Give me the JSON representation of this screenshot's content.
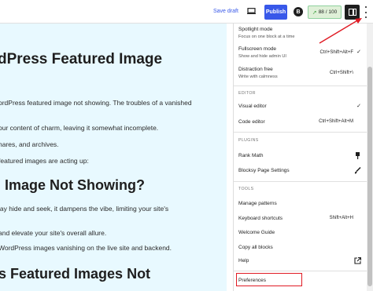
{
  "toolbar": {
    "save_draft": "Save draft",
    "publish": "Publish",
    "blocksy_letter": "B",
    "score": "88 / 100",
    "icons": [
      "desktop-preview-icon",
      "blocksy-icon",
      "rank-math-score-icon",
      "settings-panel-icon",
      "options-kebab-icon"
    ]
  },
  "canvas": {
    "heading1": "dPress Featured Image",
    "line1": "ordPress featured image not showing. The troubles of a vanished",
    "line2": "our content of charm, leaving it somewhat incomplete.",
    "line3": "hares, and archives.",
    "line4": "featured images are acting up:",
    "heading2": "Image Not Showing?",
    "line5": "lay hide and seek, it dampens the vibe, limiting your site's",
    "line6": "and elevate your site's overall allure.",
    "line7": "WordPress images vanishing on the live site and backend.",
    "heading3": "s Featured Images Not"
  },
  "menu": {
    "view": [
      {
        "label": "Spotlight mode",
        "desc": "Focus on one block at a time",
        "shortcut": "",
        "checked": false
      },
      {
        "label": "Fullscreen mode",
        "desc": "Show and hide admin UI",
        "shortcut": "Ctrl+Shift+Alt+F",
        "checked": true
      },
      {
        "label": "Distraction free",
        "desc": "Write with calmness",
        "shortcut": "Ctrl+Shift+\\",
        "checked": false
      }
    ],
    "editor_title": "EDITOR",
    "editor": [
      {
        "label": "Visual editor",
        "shortcut": "",
        "checked": true
      },
      {
        "label": "Code editor",
        "shortcut": "Ctrl+Shift+Alt+M",
        "checked": false
      }
    ],
    "plugins_title": "PLUGINS",
    "plugins": [
      {
        "label": "Rank Math"
      },
      {
        "label": "Blocksy Page Settings"
      }
    ],
    "tools_title": "TOOLS",
    "tools": [
      {
        "label": "Manage patterns",
        "shortcut": ""
      },
      {
        "label": "Keyboard shortcuts",
        "shortcut": "Shift+Alt+H"
      },
      {
        "label": "Welcome Guide",
        "shortcut": ""
      },
      {
        "label": "Copy all blocks",
        "shortcut": ""
      },
      {
        "label": "Help",
        "shortcut": ""
      }
    ],
    "preferences": "Preferences"
  },
  "colors": {
    "accent": "#3858e9",
    "canvas_bg": "#e8f9ff",
    "highlight": "#e01b24",
    "score_bg": "#dff0d8"
  }
}
